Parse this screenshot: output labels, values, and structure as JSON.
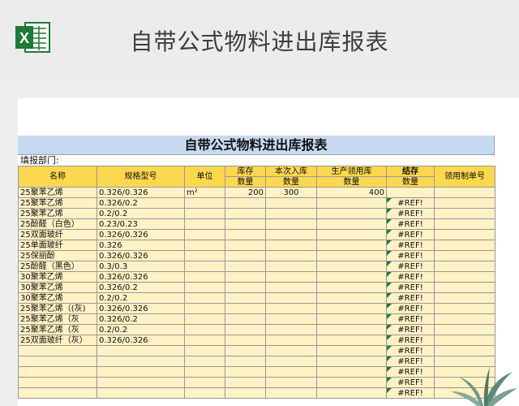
{
  "header": {
    "title": "自带公式物料进出库报表",
    "logo_icon": "excel-icon"
  },
  "sheet": {
    "title": "自带公式物料进出库报表",
    "fill_dept": "填报部门:",
    "headers": {
      "name": "名称",
      "spec": "规格型号",
      "unit": "单位",
      "stock": "库存",
      "this_in": "本次入库",
      "production": "生产领用库",
      "balance": "结存",
      "voucher": "领用制单号",
      "qty": "数量"
    },
    "rows": [
      {
        "name": "25聚苯乙烯",
        "spec": "0.326/0.326",
        "unit": "m²",
        "stock": "200",
        "in": "300",
        "prod": "400",
        "bal": ""
      },
      {
        "name": "25聚苯乙烯",
        "spec": "0.326/0.2",
        "unit": "",
        "stock": "",
        "in": "",
        "prod": "",
        "bal": "#REF!"
      },
      {
        "name": "25聚苯乙烯",
        "spec": "0.2/0.2",
        "unit": "",
        "stock": "",
        "in": "",
        "prod": "",
        "bal": "#REF!"
      },
      {
        "name": "25酚醛（白色）",
        "spec": "0.23/0.23",
        "unit": "",
        "stock": "",
        "in": "",
        "prod": "",
        "bal": "#REF!"
      },
      {
        "name": "25双面玻纤",
        "spec": "0.326/0.326",
        "unit": "",
        "stock": "",
        "in": "",
        "prod": "",
        "bal": "#REF!"
      },
      {
        "name": "25单面玻纤",
        "spec": "0.326",
        "unit": "",
        "stock": "",
        "in": "",
        "prod": "",
        "bal": "#REF!"
      },
      {
        "name": "25保丽酚",
        "spec": "0.326/0.326",
        "unit": "",
        "stock": "",
        "in": "",
        "prod": "",
        "bal": "#REF!"
      },
      {
        "name": "25酚醛（黑色）",
        "spec": "0.3/0.3",
        "unit": "",
        "stock": "",
        "in": "",
        "prod": "",
        "bal": "#REF!"
      },
      {
        "name": "30聚苯乙烯",
        "spec": "0.326/0.326",
        "unit": "",
        "stock": "",
        "in": "",
        "prod": "",
        "bal": "#REF!"
      },
      {
        "name": "30聚苯乙烯",
        "spec": "0.326/0.2",
        "unit": "",
        "stock": "",
        "in": "",
        "prod": "",
        "bal": "#REF!"
      },
      {
        "name": "30聚苯乙烯",
        "spec": "0.2/0.2",
        "unit": "",
        "stock": "",
        "in": "",
        "prod": "",
        "bal": "#REF!"
      },
      {
        "name": "25聚苯乙烯（(灰)",
        "spec": "0.326/0.326",
        "unit": "",
        "stock": "",
        "in": "",
        "prod": "",
        "bal": "#REF!"
      },
      {
        "name": "25聚苯乙烯（灰",
        "spec": "0.326/0.2",
        "unit": "",
        "stock": "",
        "in": "",
        "prod": "",
        "bal": "#REF!"
      },
      {
        "name": "25聚苯乙烯（灰",
        "spec": "0.2/0.2",
        "unit": "",
        "stock": "",
        "in": "",
        "prod": "",
        "bal": "#REF!"
      },
      {
        "name": "25双面玻纤（灰）",
        "spec": "0.326/0.326",
        "unit": "",
        "stock": "",
        "in": "",
        "prod": "",
        "bal": "#REF!"
      },
      {
        "name": "",
        "spec": "",
        "unit": "",
        "stock": "",
        "in": "",
        "prod": "",
        "bal": "#REF!"
      },
      {
        "name": "",
        "spec": "",
        "unit": "",
        "stock": "",
        "in": "",
        "prod": "",
        "bal": "#REF!"
      },
      {
        "name": "",
        "spec": "",
        "unit": "",
        "stock": "",
        "in": "",
        "prod": "",
        "bal": "#REF!"
      },
      {
        "name": "",
        "spec": "",
        "unit": "",
        "stock": "",
        "in": "",
        "prod": "",
        "bal": "#REF!"
      },
      {
        "name": "",
        "spec": "",
        "unit": "",
        "stock": "",
        "in": "",
        "prod": "",
        "bal": "#REF!"
      }
    ]
  },
  "decor": {
    "plant_icon": "potted-plant-icon"
  },
  "colors": {
    "header_yellow": "#fbd84f",
    "data_cream": "#fff2c4",
    "title_blue": "#c5d9f1",
    "excel_green": "#1f7a3a"
  }
}
